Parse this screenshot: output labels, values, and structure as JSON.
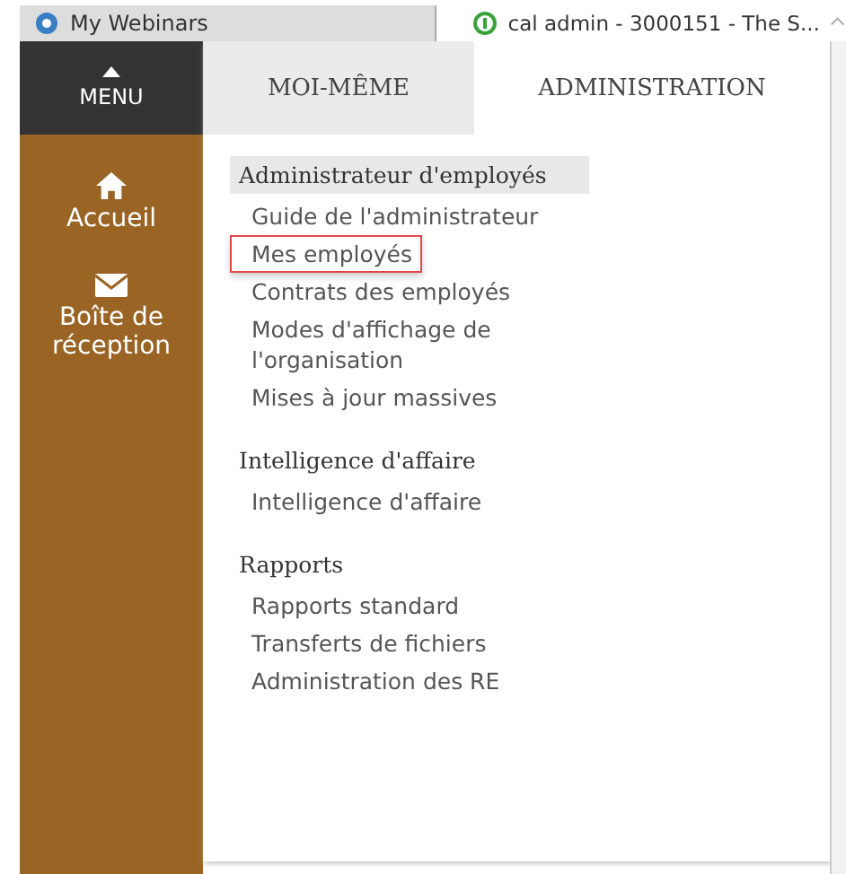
{
  "browser_tabs": [
    {
      "title": "My Webinars",
      "selected": false
    },
    {
      "title": "cal admin - 3000151 - The S...",
      "selected": true
    }
  ],
  "menu": {
    "label": "MENU",
    "items": [
      {
        "kind": "home",
        "label": "Accueil"
      },
      {
        "kind": "mail",
        "label": "Boîte de réception"
      }
    ]
  },
  "tabs": [
    {
      "label": "MOI-MÊME",
      "selected": false
    },
    {
      "label": "ADMINISTRATION",
      "selected": true
    }
  ],
  "sections": [
    {
      "title": "Administrateur d'employés",
      "selected": true,
      "items": [
        {
          "label": "Guide de l'administrateur",
          "highlighted": false
        },
        {
          "label": "Mes employés",
          "highlighted": true
        },
        {
          "label": "Contrats des employés",
          "highlighted": false
        },
        {
          "label": "Modes d'affichage de l'organisation",
          "highlighted": false
        },
        {
          "label": "Mises à jour massives",
          "highlighted": false
        }
      ]
    },
    {
      "title": "Intelligence d'affaire",
      "selected": false,
      "items": [
        {
          "label": "Intelligence d'affaire",
          "highlighted": false
        }
      ]
    },
    {
      "title": "Rapports",
      "selected": false,
      "items": [
        {
          "label": "Rapports standard",
          "highlighted": false
        },
        {
          "label": "Transferts de fichiers",
          "highlighted": false
        },
        {
          "label": "Administration des RE",
          "highlighted": false
        }
      ]
    }
  ]
}
